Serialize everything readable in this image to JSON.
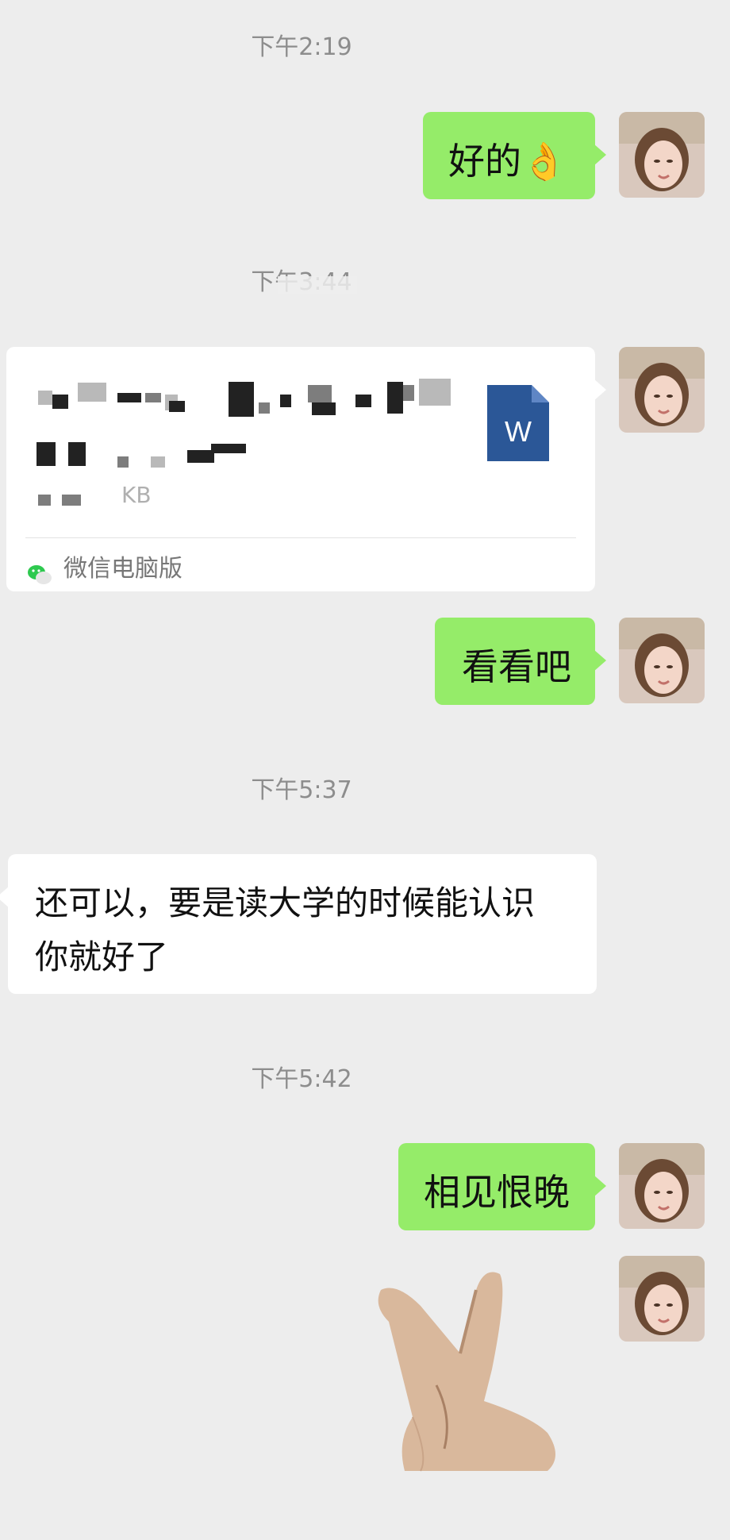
{
  "messages": [
    {
      "type": "time",
      "text": "下午2:19"
    },
    {
      "type": "sent",
      "text": "好的👌"
    },
    {
      "type": "time",
      "text": "下午3:44"
    },
    {
      "type": "file",
      "icon": "word-file-icon",
      "icon_letter": "W",
      "size_text": "KB",
      "source": "微信电脑版"
    },
    {
      "type": "sent",
      "text": "看看吧"
    },
    {
      "type": "time",
      "text": "下午5:37"
    },
    {
      "type": "received",
      "line1": "还可以，要是读大学的时候能认识",
      "line2": "你就好了"
    },
    {
      "type": "time",
      "text": "下午5:42"
    },
    {
      "type": "sent",
      "text": "相见恨晚"
    },
    {
      "type": "sticker",
      "name": "finger-heart-sticker"
    }
  ],
  "colors": {
    "background": "#ededed",
    "sent_bubble": "#95ec69",
    "received_bubble": "#ffffff",
    "word_icon": "#2b5797",
    "timestamp": "#8d8d8d"
  }
}
